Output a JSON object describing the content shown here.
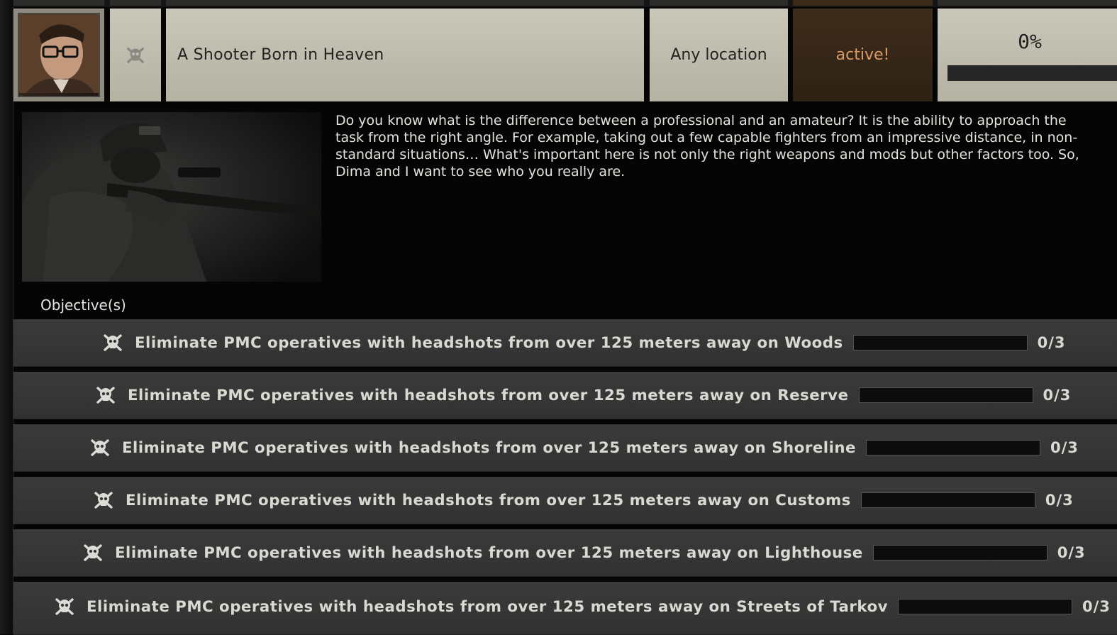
{
  "quest": {
    "title": "A Shooter Born in Heaven",
    "location": "Any location",
    "status": "active!",
    "progress_text": "0%",
    "progress_fraction": 0,
    "description": "Do you know what is the difference between a professional and an amateur? It is the ability to approach the task from the right angle. For example, taking out a few capable fighters from an impressive distance, in non-standard situations… What's important here is not only the right weapons and mods but other factors too. So, Dima and I want to see who you really are.",
    "type_icon": "skull-crossbones-icon",
    "colors": {
      "header_bg": "#c2bfb1",
      "status_bg": "#3a2a1a",
      "status_text": "#d89b68",
      "row_bg": "#363636"
    }
  },
  "objectives_label": "Objective(s)",
  "objectives": [
    {
      "text": "Eliminate PMC operatives with headshots from over 125 meters away on Woods",
      "count": "0/3",
      "progress": 0
    },
    {
      "text": "Eliminate PMC operatives with headshots from over 125 meters away on Reserve",
      "count": "0/3",
      "progress": 0
    },
    {
      "text": "Eliminate PMC operatives with headshots from over 125 meters away on Shoreline",
      "count": "0/3",
      "progress": 0
    },
    {
      "text": "Eliminate PMC operatives with headshots from over 125 meters away on Customs",
      "count": "0/3",
      "progress": 0
    },
    {
      "text": "Eliminate PMC operatives with headshots from over 125 meters away on Lighthouse",
      "count": "0/3",
      "progress": 0
    },
    {
      "text": "Eliminate PMC operatives with headshots from over 125 meters away on Streets of Tarkov",
      "count": "0/3",
      "progress": 0
    }
  ]
}
